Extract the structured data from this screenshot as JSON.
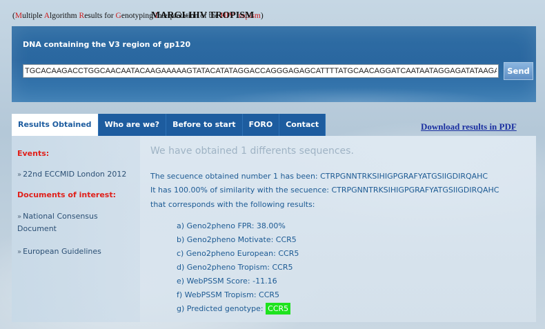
{
  "header": {
    "title_main": "MARGI-HIV TROPISM",
    "subtitle_parts": [
      {
        "text": "(",
        "hl": false
      },
      {
        "text": "M",
        "hl": true
      },
      {
        "text": "ultiple ",
        "hl": false
      },
      {
        "text": "A",
        "hl": true
      },
      {
        "text": "lgorithm ",
        "hl": false
      },
      {
        "text": "R",
        "hl": true
      },
      {
        "text": "esults for ",
        "hl": false
      },
      {
        "text": "G",
        "hl": true
      },
      {
        "text": "enotyping ",
        "hl": false
      },
      {
        "text": "I",
        "hl": true
      },
      {
        "text": "nterpretation of the ",
        "hl": false
      },
      {
        "text": "HIV tropism",
        "hl": true
      },
      {
        "text": ")",
        "hl": false
      }
    ]
  },
  "dna_form": {
    "label": "DNA containing the V3 region of gp120",
    "value": "TGCACAAGACCTGGCAACAATACAAGAAAAAGTATACATATAGGACCAGGGAGAGCATTTTATGCAACAGGATCAATAATAGGAGATATAAGACAAGCACAT",
    "send_label": "Send"
  },
  "tabs": [
    {
      "label": "Results Obtained",
      "active": true
    },
    {
      "label": "Who are we?",
      "active": false
    },
    {
      "label": "Before to start",
      "active": false
    },
    {
      "label": "FORO",
      "active": false
    },
    {
      "label": "Contact",
      "active": false
    }
  ],
  "download_label": "Download results in PDF",
  "sidebar": {
    "events_heading": "Events:",
    "events": [
      {
        "label": "22nd ECCMID London 2012"
      }
    ],
    "documents_heading": "Documents of interest:",
    "documents": [
      {
        "label": "National Consensus Document"
      },
      {
        "label": "European Guidelines"
      }
    ]
  },
  "main": {
    "heading": "We have obtained 1 differents sequences.",
    "line1": "The secuence obtained number 1 has been: CTRPGNNTRKSIHIGPGRAFYATGSIIGDIRQAHC",
    "line2": "It has 100.00% of similarity with the secuence: CTRPGNNTRKSIHIGPGRAFYATGSIIGDIRQAHC",
    "line3": "that corresponds with the following results:",
    "results": [
      "a) Geno2pheno FPR: 38.00%",
      "b) Geno2pheno Motivate: CCR5",
      "c) Geno2pheno European: CCR5",
      "d) Geno2pheno Tropism: CCR5",
      "e) WebPSSM Score: -11.16",
      "f) WebPSSM Tropism: CCR5"
    ],
    "predicted_label": "g) Predicted genotype:",
    "predicted_value": "CCR5"
  },
  "colors": {
    "accent_blue": "#1d5c9f",
    "highlight_red": "#cc1a1a",
    "predicted_badge": "#1ee31e"
  }
}
